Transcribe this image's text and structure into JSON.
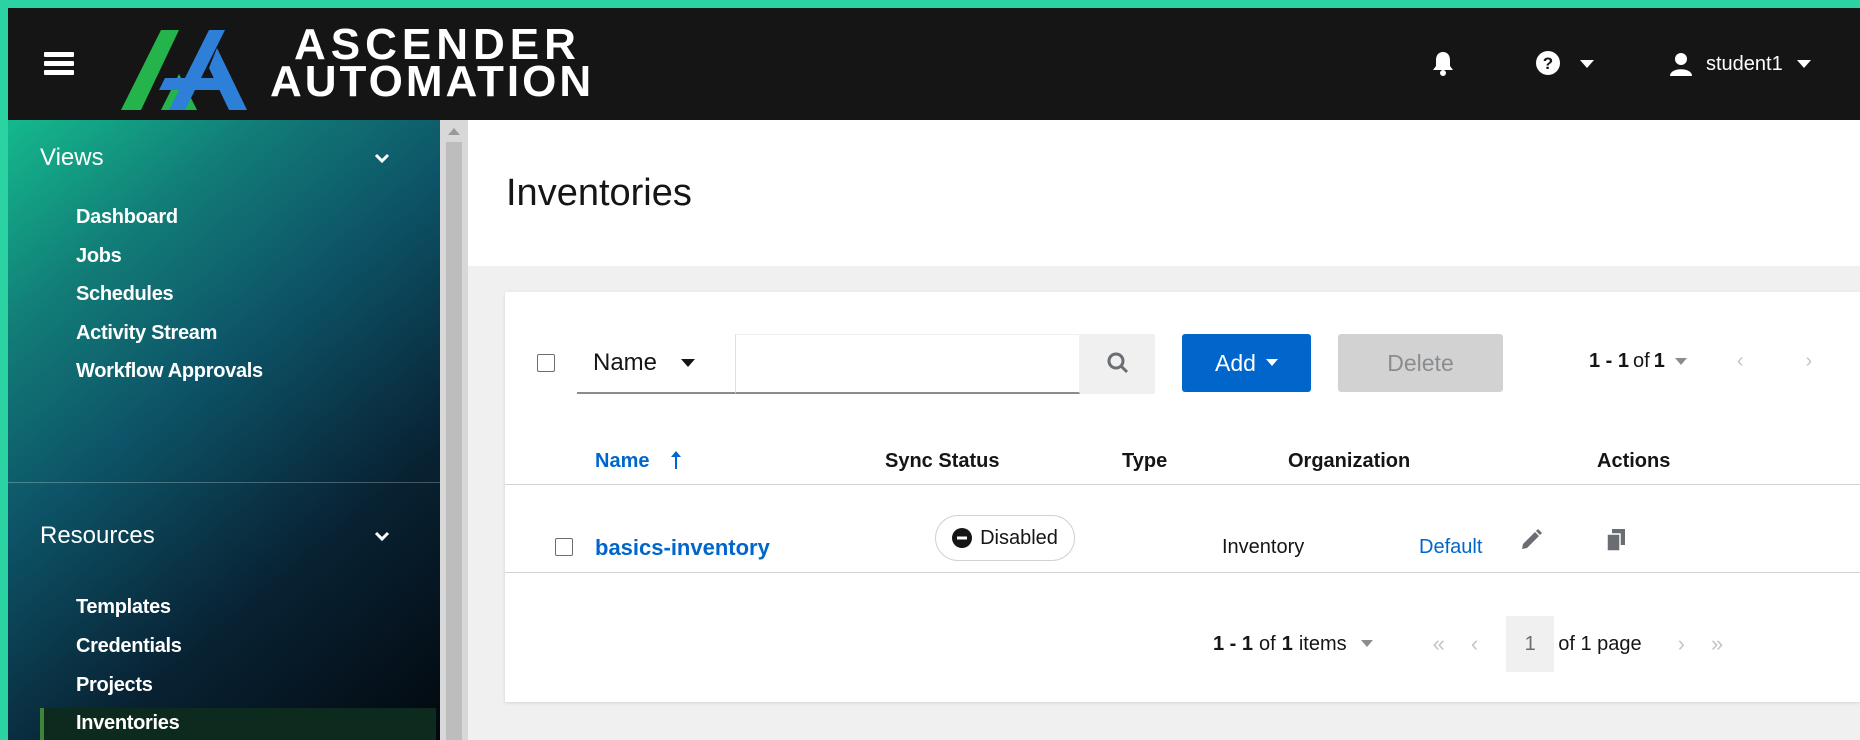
{
  "brand": {
    "line1": "ASCENDER",
    "line2": "AUTOMATION"
  },
  "topbar": {
    "user_name": "student1"
  },
  "sidebar": {
    "groups": [
      {
        "label": "Views",
        "items": [
          "Dashboard",
          "Jobs",
          "Schedules",
          "Activity Stream",
          "Workflow Approvals"
        ]
      },
      {
        "label": "Resources",
        "items": [
          "Templates",
          "Credentials",
          "Projects",
          "Inventories"
        ]
      }
    ],
    "active_item": "Inventories"
  },
  "page": {
    "title": "Inventories"
  },
  "toolbar": {
    "filter_selected": "Name",
    "search_value": "",
    "add_label": "Add",
    "delete_label": "Delete",
    "pagination_range": "1 - 1",
    "pagination_of": "of",
    "pagination_total": "1"
  },
  "table": {
    "columns": [
      "Name",
      "Sync Status",
      "Type",
      "Organization",
      "Actions"
    ],
    "rows": [
      {
        "name": "basics-inventory",
        "sync_status": "Disabled",
        "type": "Inventory",
        "organization": "Default"
      }
    ]
  },
  "pagination": {
    "range": "1 - 1",
    "of_word": "of",
    "total": "1",
    "items_word": "items",
    "current_page": "1",
    "of_pages": "of 1 page"
  },
  "colors": {
    "primary": "#0066cc",
    "topbar": "#151515",
    "active": "#3e8635"
  },
  "icons": [
    "hamburger-icon",
    "bell-icon",
    "help-icon",
    "user-icon",
    "search-icon",
    "sort-up-icon",
    "disabled-icon",
    "pencil-icon",
    "copy-icon"
  ]
}
